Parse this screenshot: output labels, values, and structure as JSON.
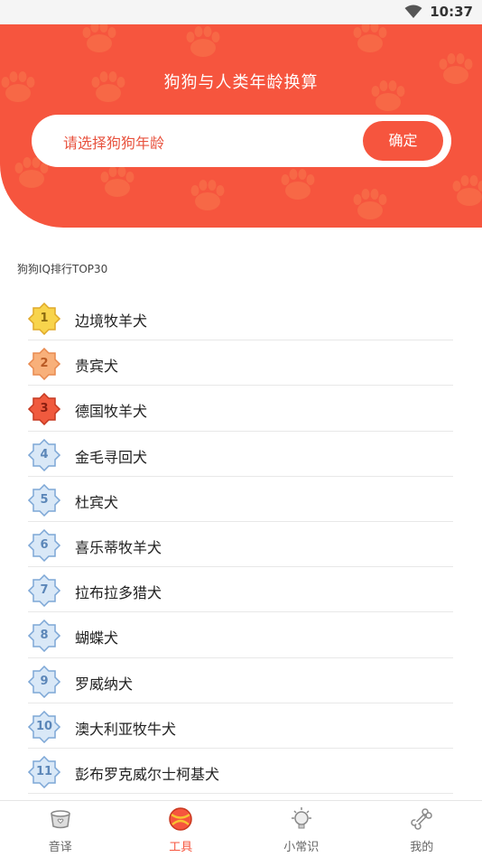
{
  "status_bar": {
    "time": "10:37"
  },
  "header": {
    "title": "狗狗与人类年龄换算",
    "search_placeholder": "请选择狗狗年龄",
    "confirm_label": "确定",
    "accent_color": "#f6553e"
  },
  "section_title": "狗狗IQ排行TOP30",
  "ranking": [
    {
      "rank": "1",
      "name": "边境牧羊犬",
      "badge": "gold"
    },
    {
      "rank": "2",
      "name": "贵宾犬",
      "badge": "orange"
    },
    {
      "rank": "3",
      "name": "德国牧羊犬",
      "badge": "red"
    },
    {
      "rank": "4",
      "name": "金毛寻回犬",
      "badge": "blue"
    },
    {
      "rank": "5",
      "name": "杜宾犬",
      "badge": "blue"
    },
    {
      "rank": "6",
      "name": "喜乐蒂牧羊犬",
      "badge": "blue"
    },
    {
      "rank": "7",
      "name": "拉布拉多猎犬",
      "badge": "blue"
    },
    {
      "rank": "8",
      "name": "蝴蝶犬",
      "badge": "blue"
    },
    {
      "rank": "9",
      "name": "罗威纳犬",
      "badge": "blue"
    },
    {
      "rank": "10",
      "name": "澳大利亚牧牛犬",
      "badge": "blue"
    },
    {
      "rank": "11",
      "name": "彭布罗克威尔士柯基犬",
      "badge": "blue"
    }
  ],
  "tabs": [
    {
      "label": "音译",
      "icon": "dog-bowl-icon",
      "active": false
    },
    {
      "label": "工具",
      "icon": "ball-icon",
      "active": true
    },
    {
      "label": "小常识",
      "icon": "lightbulb-icon",
      "active": false
    },
    {
      "label": "我的",
      "icon": "bone-icon",
      "active": false
    }
  ]
}
